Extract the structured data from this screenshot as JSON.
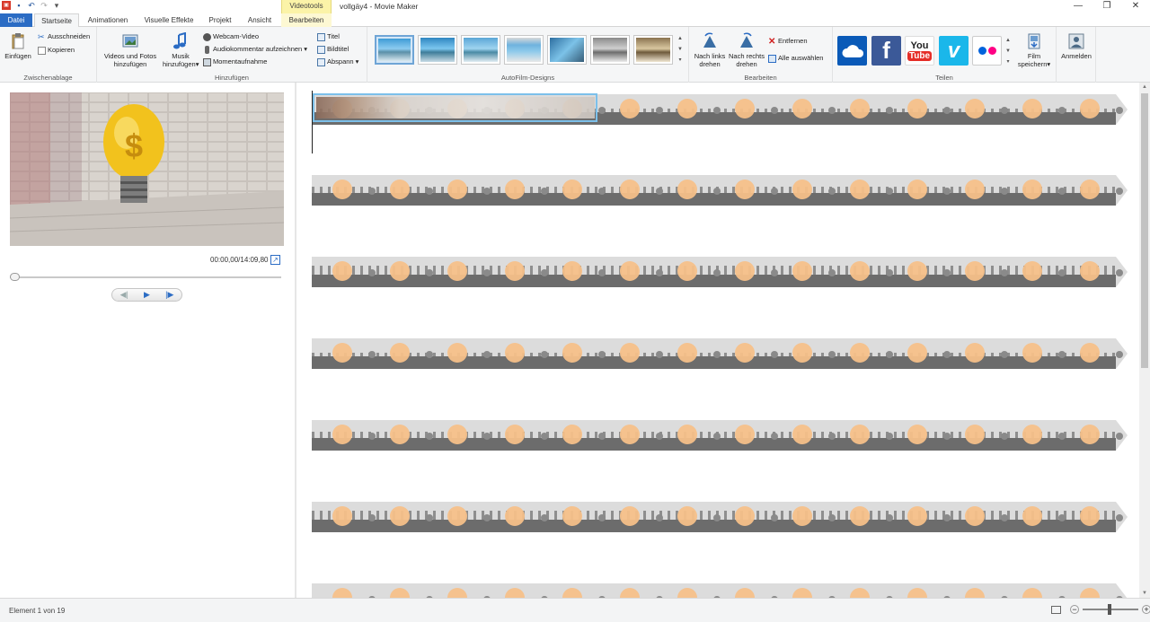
{
  "window": {
    "title": "vollgäy4 - Movie Maker",
    "context_tab": "Videotools",
    "minimize": "—",
    "maximize": "❐",
    "close": "✕"
  },
  "quick_access": [
    "app-menu-icon",
    "save-icon",
    "undo-icon",
    "redo-icon",
    "dropdown-icon"
  ],
  "tabs": [
    {
      "label": "Datei"
    },
    {
      "label": "Startseite"
    },
    {
      "label": "Animationen"
    },
    {
      "label": "Visuelle Effekte"
    },
    {
      "label": "Projekt"
    },
    {
      "label": "Ansicht"
    },
    {
      "label": "Bearbeiten"
    }
  ],
  "ribbon": {
    "clipboard": {
      "label": "Zwischenablage",
      "paste": "Einfügen",
      "cut": "Ausschneiden",
      "copy": "Kopieren"
    },
    "add": {
      "label": "Hinzufügen",
      "videos_photos_line1": "Videos und Fotos",
      "videos_photos_line2": "hinzufügen",
      "music_line1": "Musik",
      "music_line2": "hinzufügen",
      "webcam": "Webcam-Video",
      "audio_comment": "Audiokommentar aufzeichnen",
      "snapshot": "Momentaufnahme",
      "title": "Titel",
      "caption": "Bildtitel",
      "credits": "Abspann"
    },
    "themes": {
      "label": "AutoFilm-Designs",
      "count": 8,
      "selected_index": 0
    },
    "edit": {
      "label": "Bearbeiten",
      "rotate_left_line1": "Nach links",
      "rotate_left_line2": "drehen",
      "rotate_right_line1": "Nach rechts",
      "rotate_right_line2": "drehen",
      "remove": "Entfernen",
      "select_all": "Alle auswählen"
    },
    "share": {
      "label": "Teilen",
      "services": [
        {
          "name": "onedrive-icon",
          "color": "#0a5ab8"
        },
        {
          "name": "facebook-icon",
          "color": "#3b5998"
        },
        {
          "name": "youtube-icon",
          "color": "#e52d27"
        },
        {
          "name": "vimeo-icon",
          "color": "#1ab7ea"
        },
        {
          "name": "flickr-icon",
          "color": "#ffffff"
        }
      ],
      "youtube_you": "You",
      "youtube_tube": "Tube",
      "vimeo_letter": "v",
      "save_movie_line1": "Film",
      "save_movie_line2": "speichern"
    },
    "signin": "Anmelden"
  },
  "preview": {
    "timecode": "00:00,00/14:09,80",
    "prev_frame": "◀|",
    "play": "▶",
    "next_frame": "|▶"
  },
  "storyboard": {
    "rows": 7,
    "selected_clip": 1
  },
  "status": {
    "text": "Element 1 von 19",
    "zoom_out": "−",
    "zoom_in": "+"
  }
}
